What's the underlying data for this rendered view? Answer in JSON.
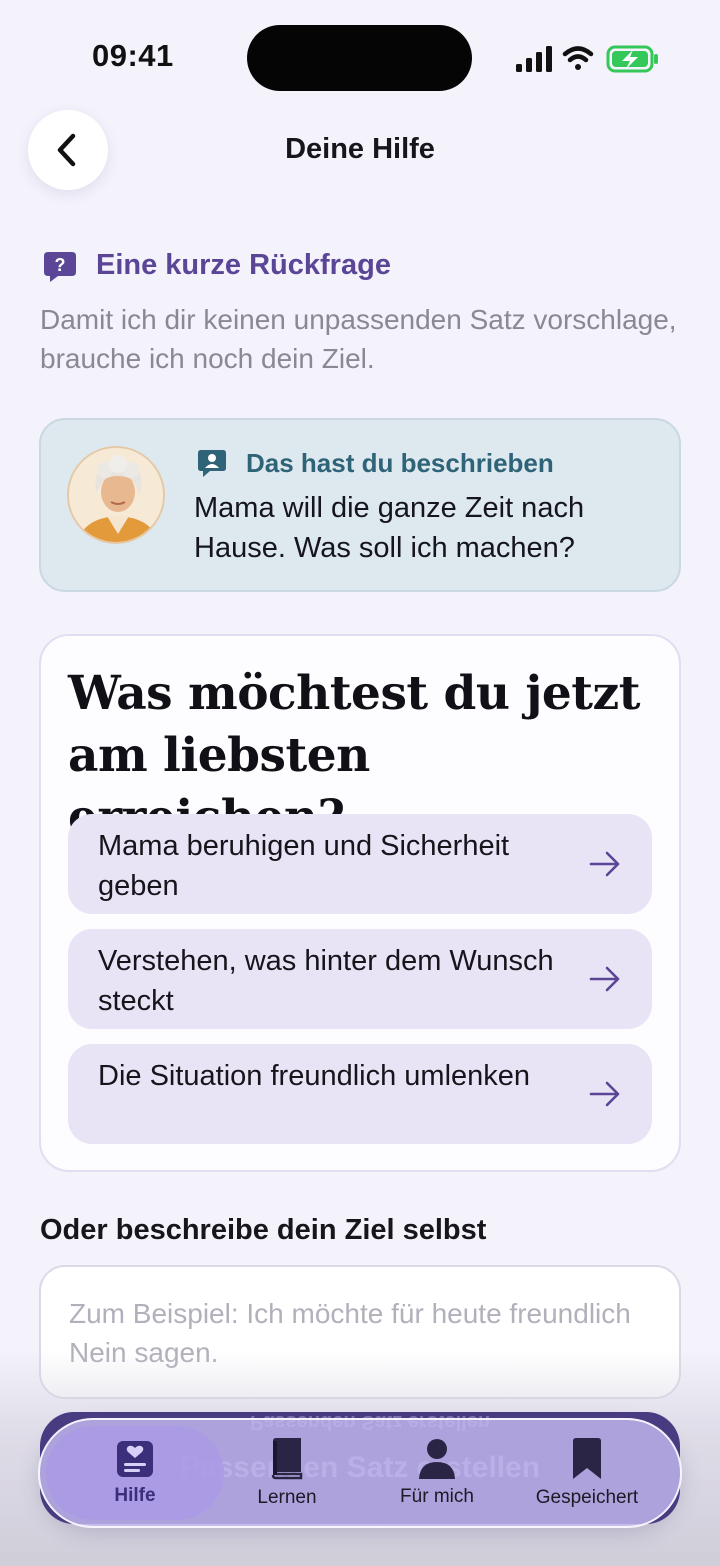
{
  "status_bar": {
    "time": "09:41"
  },
  "header": {
    "title": "Deine Hilfe"
  },
  "clarification": {
    "title": "Eine kurze Rückfrage",
    "description": "Damit ich dir keinen unpassenden Satz vorschlage, brauche ich noch dein Ziel."
  },
  "described": {
    "label": "Das hast du beschrieben",
    "text": "Mama will die ganze Zeit nach Hause. Was soll ich machen?"
  },
  "goal": {
    "title": "Was möchtest du jetzt am liebsten erreichen?",
    "options": [
      {
        "label": "Mama beruhigen und Sicherheit geben"
      },
      {
        "label": "Verstehen, was hinter dem Wunsch steckt"
      },
      {
        "label": "Die Situation freundlich umlenken"
      }
    ]
  },
  "custom": {
    "label": "Oder beschreibe dein Ziel selbst",
    "placeholder": "Zum Beispiel: Ich möchte für heute freundlich Nein sagen."
  },
  "submit": {
    "label": "Passenden Satz erstellen"
  },
  "tabs": [
    {
      "label": "Hilfe",
      "icon": "heart-card-icon",
      "active": true
    },
    {
      "label": "Lernen",
      "icon": "book-icon",
      "active": false
    },
    {
      "label": "Für mich",
      "icon": "person-icon",
      "active": false
    },
    {
      "label": "Gespeichert",
      "icon": "bookmark-icon",
      "active": false
    }
  ],
  "colors": {
    "accent": "#5a4596",
    "background": "#f4f2fb",
    "described_card": "#dde8ef",
    "option": "#e9e3f6",
    "tabbar": "#c4b8f0"
  }
}
